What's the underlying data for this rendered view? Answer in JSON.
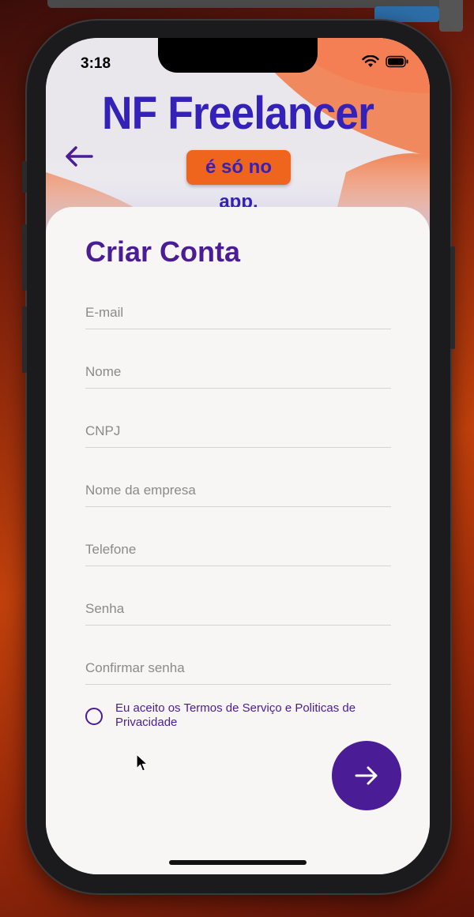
{
  "status_bar": {
    "time": "3:18"
  },
  "hero": {
    "title": "NF Freelancer",
    "badge": "é só no app."
  },
  "form": {
    "title": "Criar Conta",
    "fields": [
      {
        "placeholder": "E-mail"
      },
      {
        "placeholder": "Nome"
      },
      {
        "placeholder": "CNPJ"
      },
      {
        "placeholder": "Nome da empresa"
      },
      {
        "placeholder": "Telefone"
      },
      {
        "placeholder": "Senha"
      },
      {
        "placeholder": "Confirmar senha"
      }
    ],
    "terms_label": "Eu aceito os Termos de Serviço e Politicas de Privacidade"
  },
  "colors": {
    "primary": "#4a1d96",
    "title_blue": "#3422b8",
    "accent_orange": "#f0651e"
  },
  "icons": {
    "back": "arrow-left-icon",
    "next": "arrow-right-icon",
    "wifi": "wifi-icon",
    "battery": "battery-icon"
  }
}
